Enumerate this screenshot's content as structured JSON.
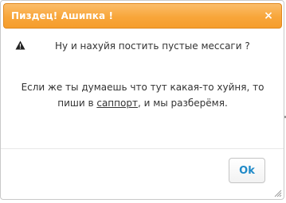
{
  "dialog": {
    "title": "Пиздец! Ашипка !",
    "close_glyph": "×",
    "icon": "warning-triangle-icon",
    "question": "Ну и нахуйя постить пустые мессаги ?",
    "body_line1": "Если же ты думаешь что тут какая-то хуйня, то",
    "body_line2_prefix": "пиши в ",
    "support_link": "саппорт",
    "body_line2_suffix": ", и мы разберёмя.",
    "ok_label": "Ok"
  },
  "colors": {
    "titlebar": "#f8a63a",
    "ok_text": "#1f8ac8"
  }
}
